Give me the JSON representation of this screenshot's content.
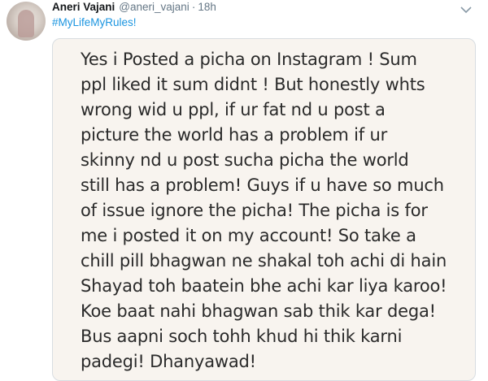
{
  "tweet": {
    "display_name": "Aneri Vajani",
    "handle": "@aneri_vajani",
    "separator": "·",
    "time": "18h",
    "hashtag": "#MyLifeMyRules!",
    "image_text_lines": [
      "Yes i Posted a picha on Instagram ! Sum",
      "ppl liked it sum didnt ! But honestly whts",
      "wrong wid u ppl, if ur fat nd u post a",
      "picture the world has a problem if ur",
      "skinny nd u post sucha picha the world",
      "still has a problem! Guys if u have so much",
      "of issue ignore the picha! The picha is for",
      "me i posted it on my account! So take a",
      "chill pill bhagwan ne shakal toh achi di hain",
      "Shayad toh baatein bhe achi kar liya karoo!",
      "Koe baat nahi bhagwan sab thik kar dega!",
      "Bus aapni soch tohh khud hi thik karni",
      "padegi! Dhanyawad!"
    ]
  },
  "colors": {
    "name": "#14171a",
    "secondary": "#657786",
    "link": "#1b95e0",
    "note_background": "#f8f4ef"
  },
  "icons": {
    "avatar": "profile-photo",
    "menu": "chevron-down-icon"
  }
}
